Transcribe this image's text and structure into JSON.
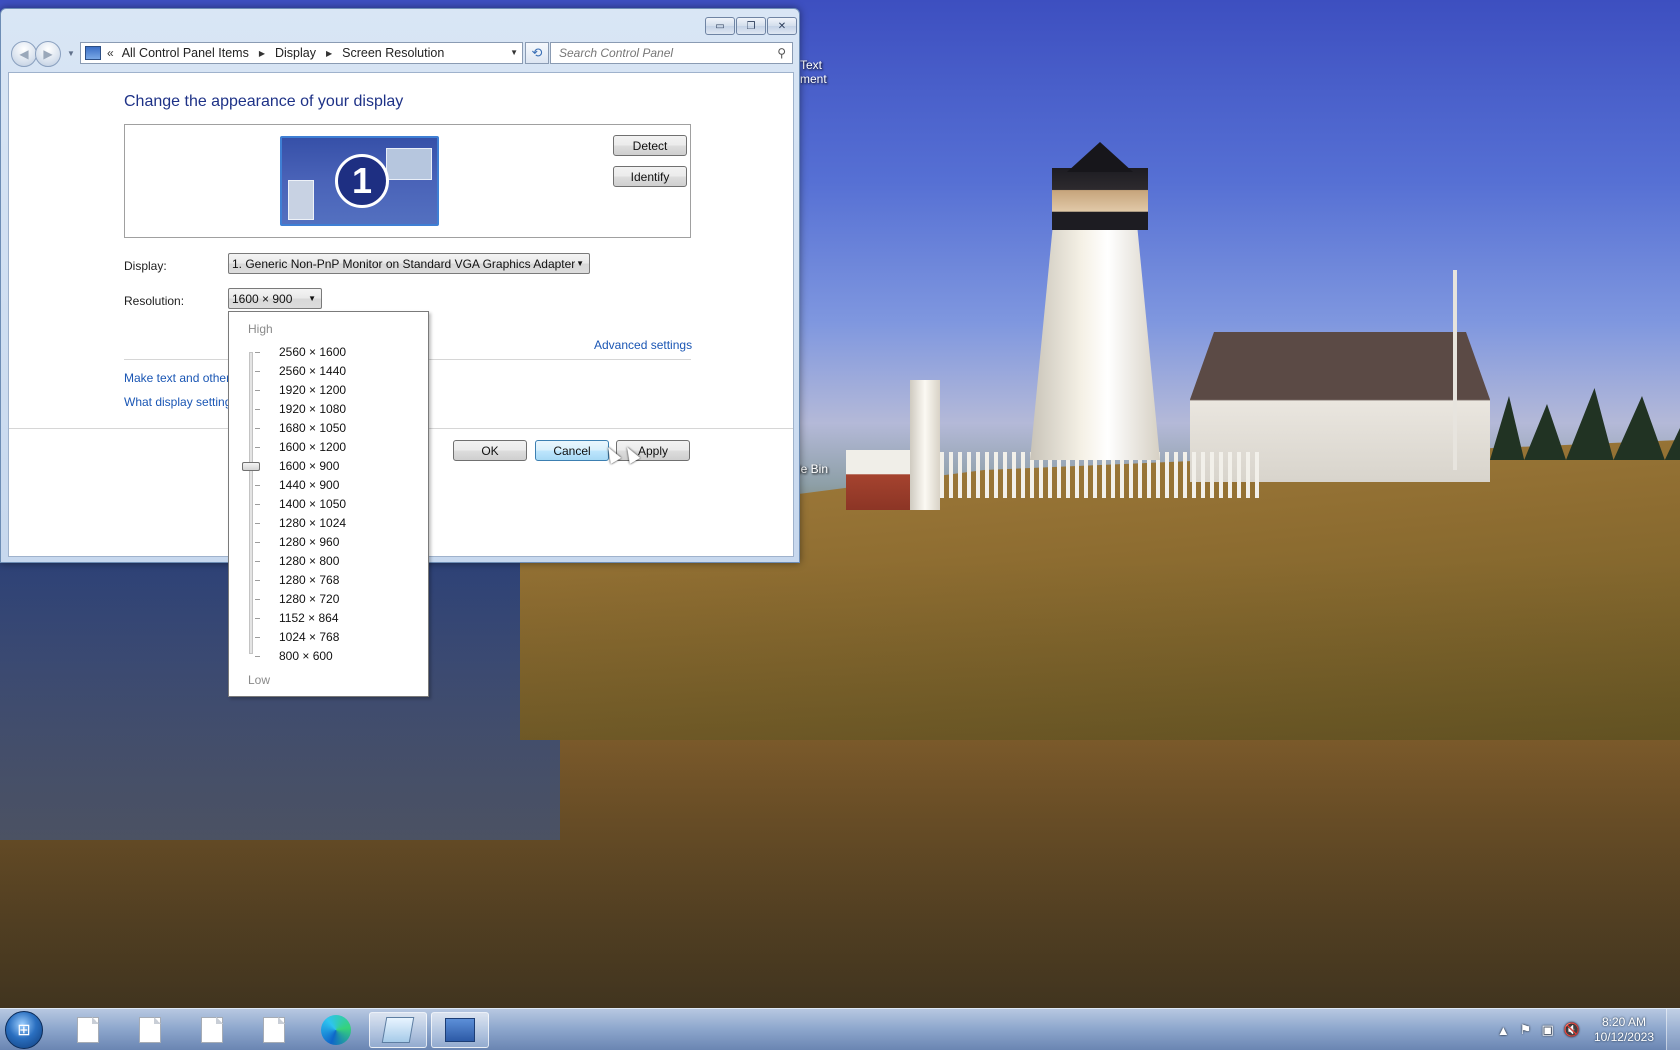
{
  "window": {
    "caption_buttons": {
      "minimize": "▭",
      "restore": "❐",
      "close": "✕"
    },
    "breadcrumb": [
      "All Control Panel Items",
      "Display",
      "Screen Resolution"
    ],
    "breadcrumb_prefix": "«",
    "search_placeholder": "Search Control Panel"
  },
  "main": {
    "title": "Change the appearance of your display",
    "monitor_number": "1",
    "detect_label": "Detect",
    "identify_label": "Identify",
    "display_label": "Display:",
    "display_value": "1. Generic Non-PnP Monitor on Standard VGA Graphics Adapter",
    "resolution_label": "Resolution:",
    "resolution_value": "1600 × 900",
    "advanced_link": "Advanced settings",
    "link_text_size": "Make text and other",
    "link_what_settings": "What display setting",
    "ok_label": "OK",
    "cancel_label": "Cancel",
    "apply_label": "Apply"
  },
  "dropdown": {
    "high_label": "High",
    "low_label": "Low",
    "selected_index": 6,
    "options": [
      "2560 × 1600",
      "2560 × 1440",
      "1920 × 1200",
      "1920 × 1080",
      "1680 × 1050",
      "1600 × 1200",
      "1600 × 900",
      "1440 × 900",
      "1400 × 1050",
      "1280 × 1024",
      "1280 × 960",
      "1280 × 800",
      "1280 × 768",
      "1280 × 720",
      "1152 × 864",
      "1024 × 768",
      "800 × 600"
    ]
  },
  "desktop": {
    "icon_fragment_1a": "Text",
    "icon_fragment_1b": "ment",
    "icon_fragment_2": "le Bin"
  },
  "taskbar": {
    "start_icon": "start-orb-icon",
    "time": "8:20 AM",
    "date": "10/12/2023"
  }
}
